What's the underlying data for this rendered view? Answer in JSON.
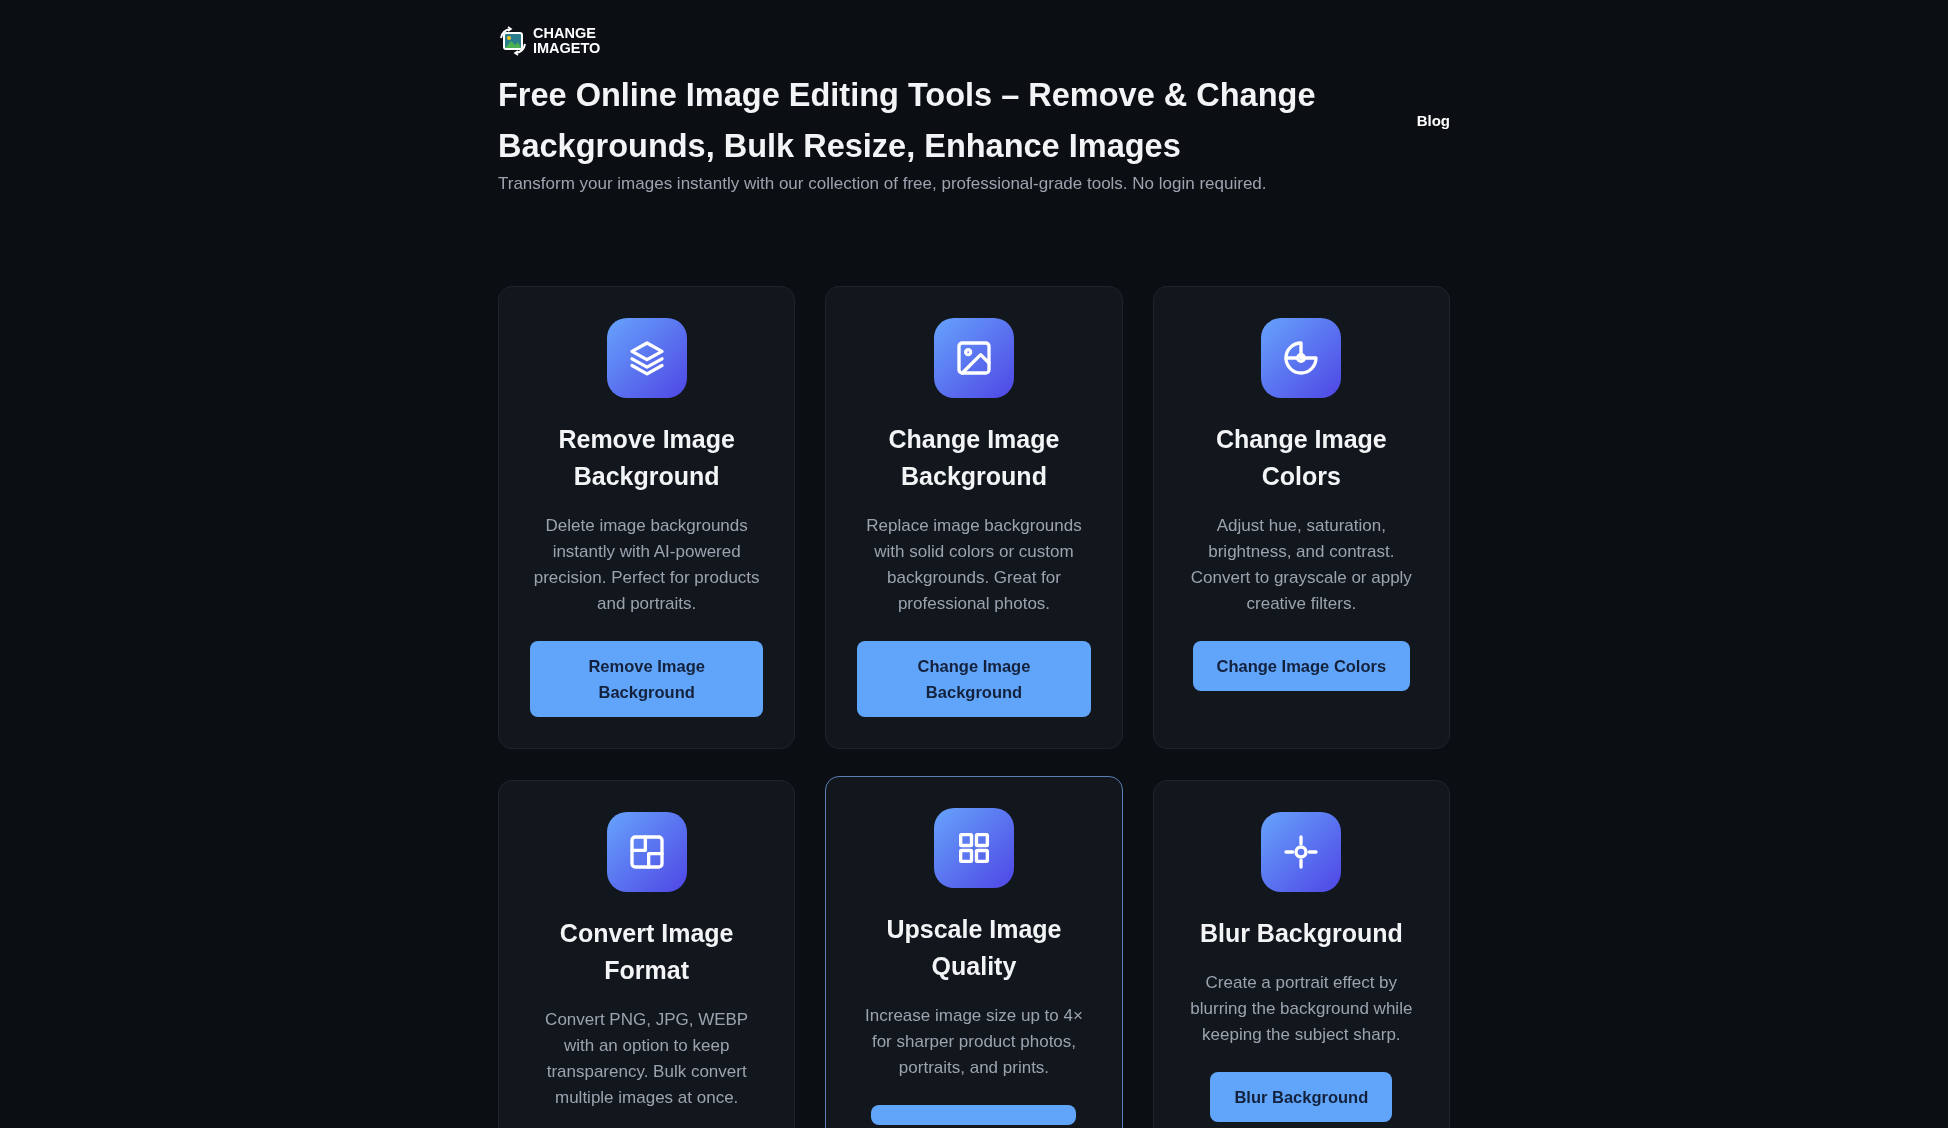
{
  "logo": {
    "text": "CHANGE IMAGETO"
  },
  "header": {
    "title": "Free Online Image Editing Tools – Remove & Change Backgrounds, Bulk Resize, Enhance Images",
    "nav": [
      {
        "label": "Blog"
      }
    ],
    "subtitle": "Transform your images instantly with our collection of free, professional-grade tools. No login required."
  },
  "cards": [
    {
      "kind": "layers",
      "title": "Remove Image Background",
      "description": "Delete image backgrounds instantly with AI-powered precision. Perfect for products and portraits.",
      "button": {
        "label": "Remove Image Background"
      },
      "highlighted": false
    },
    {
      "kind": "image",
      "title": "Change Image Background",
      "description": "Replace image backgrounds with solid colors or custom backgrounds. Great for professional photos.",
      "button": {
        "label": "Change Image Background"
      },
      "highlighted": false
    },
    {
      "kind": "pie",
      "title": "Change Image Colors",
      "description": "Adjust hue, saturation, brightness, and contrast. Convert to grayscale or apply creative filters.",
      "button": {
        "label": "Change Image Colors"
      },
      "highlighted": false
    },
    {
      "kind": "layout",
      "title": "Convert Image Format",
      "description": "Convert PNG, JPG, WEBP with an option to keep transparency. Bulk convert multiple images at once.",
      "highlighted": false
    },
    {
      "kind": "grid",
      "title": "Upscale Image Quality",
      "description": "Increase image size up to 4× for sharper product photos, portraits, and prints.",
      "button": {
        "cut_off": true
      },
      "highlighted": true
    },
    {
      "kind": "crosshair",
      "title": "Blur Background",
      "description": "Create a portrait effect by blurring the background while keeping the subject sharp.",
      "button": {
        "label": "Blur Background"
      },
      "highlighted": false
    }
  ]
}
